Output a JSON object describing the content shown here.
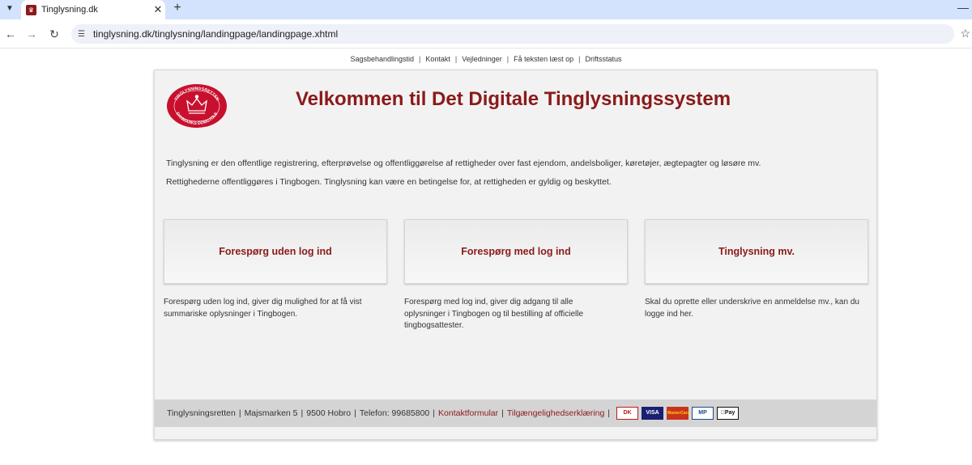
{
  "browser": {
    "tab_title": "Tinglysning.dk",
    "url": "tinglysning.dk/tinglysning/landingpage/landingpage.xhtml"
  },
  "topnav": {
    "items": [
      "Sagsbehandlingstid",
      "Kontakt",
      "Vejledninger",
      "Få teksten læst op",
      "Driftsstatus"
    ]
  },
  "header": {
    "title": "Velkommen til Det Digitale Tinglysningssystem",
    "logo_text_top": "TINGLYSNINGSRETTEN",
    "logo_text_bottom": "DANMARKS DOMSTOLE"
  },
  "intro": {
    "p1": "Tinglysning er den offentlige registrering, efterprøvelse og offentliggørelse af rettigheder over fast ejendom, andelsboliger, køretøjer, ægtepagter og løsøre mv.",
    "p2": "Rettighederne offentliggøres i Tingbogen. Tinglysning kan være en betingelse for, at rettigheden er gyldig og beskyttet."
  },
  "options": [
    {
      "label": "Forespørg uden log ind",
      "description": "Forespørg uden log ind, giver dig mulighed for at få vist summariske oplysninger i Tingbogen."
    },
    {
      "label": "Forespørg med log ind",
      "description": "Forespørg med log ind, giver dig adgang til alle oplysninger i Tingbogen og til bestilling af officielle tingbogsattester."
    },
    {
      "label": "Tinglysning mv.",
      "description": "Skal du oprette eller underskrive en anmeldelse mv., kan du logge ind her."
    }
  ],
  "footer": {
    "org": "Tinglysningsretten",
    "address": "Majsmarken 5",
    "city": "9500 Hobro",
    "phone": "Telefon: 99685800",
    "contact_link": "Kontaktformular",
    "accessibility_link": "Tilgængelighedserklæring",
    "payments": [
      "DK",
      "VISA",
      "MasterCard",
      "MP",
      "Pay"
    ]
  },
  "colors": {
    "brand": "#8b1a1a",
    "card_bg": "#f2f2f2",
    "footer_bg": "#d4d4d4"
  }
}
